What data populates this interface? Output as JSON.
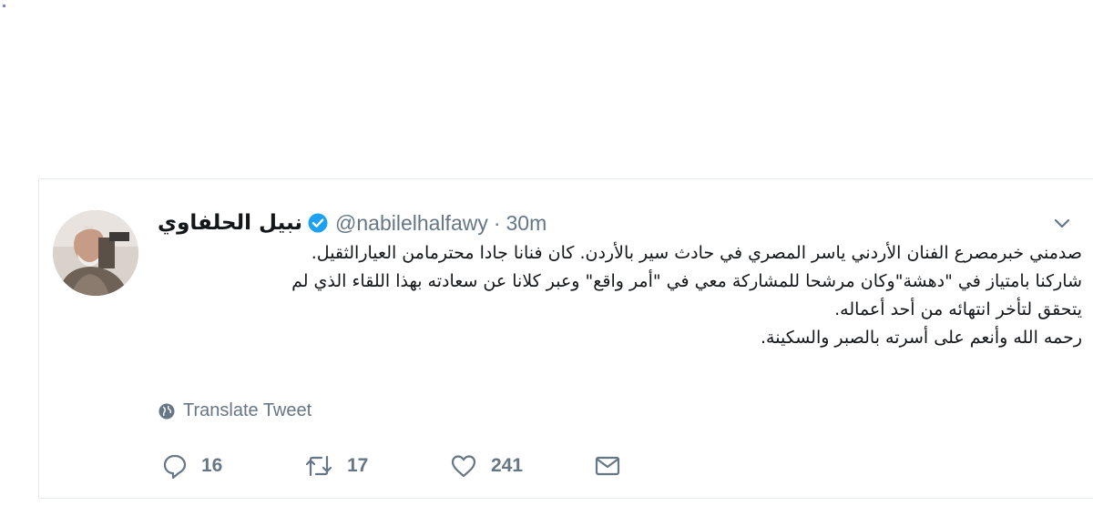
{
  "tweet": {
    "display_name": "نبيل الحلفاوي",
    "handle": "@nabilelhalfawy",
    "separator": "·",
    "time": "30m",
    "verified_color": "#1da1f2",
    "lines": [
      "صدمني خبرمصرع الفنان الأردني ياسر المصري في حادث سير بالأردن. كان فنانا جادا محترمامن العيارالثقيل.",
      "شاركنا بامتياز في \"دهشة\"وكان مرشحا للمشاركة معي في \"أمر واقع\" وعبر كلانا عن سعادته بهذا اللقاء الذي لم",
      "يتحقق لتأخر انتهائه من أحد أعماله.",
      "رحمه الله وأنعم على أسرته بالصبر والسكينة."
    ],
    "translate_label": "Translate Tweet",
    "icons": {
      "menu": "chevron-down-icon",
      "translate": "globe-icon",
      "reply": "reply-icon",
      "retweet": "retweet-icon",
      "like": "heart-icon",
      "dm": "envelope-icon"
    }
  },
  "stats": {
    "replies": "16",
    "retweets": "17",
    "likes": "241"
  }
}
